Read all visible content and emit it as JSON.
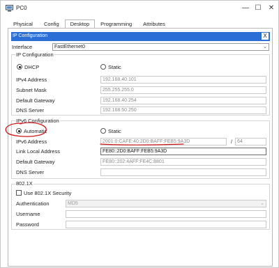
{
  "window": {
    "title": "PC0"
  },
  "tabs": [
    "Physical",
    "Config",
    "Desktop",
    "Programming",
    "Attributes"
  ],
  "ip_config": {
    "header": "IP Configuration",
    "close": "X",
    "interface_label": "Interface",
    "interface_value": "FastEthernet0",
    "ipv4_section": "IP Configuration",
    "dhcp_label": "DHCP",
    "static_label": "Static",
    "ipv4_address_label": "IPv4 Address",
    "ipv4_address": "192.168.40.101",
    "subnet_mask_label": "Subnet Mask",
    "subnet_mask": "255.255.255.0",
    "default_gateway_label": "Default Gateway",
    "default_gateway": "192.168.40.254",
    "dns_server_label": "DNS Server",
    "dns_server": "192.168.50.250",
    "ipv6_section": "IPv6 Configuration",
    "automatic_label": "Automatic",
    "static6_label": "Static",
    "ipv6_address_label": "IPv6 Address",
    "ipv6_address": "2001:0:CAFE:40:2D0:BAFF:FEB5:9A3D",
    "slash": "/",
    "prefix": "64",
    "link_local_label": "Link Local Address",
    "link_local": "FE80::2D0:BAFF:FEB5:9A3D",
    "default_gateway6_label": "Default Gateway",
    "default_gateway6": "FE80::202:4AFF:FE4C:8801",
    "dns_server6_label": "DNS Server",
    "dns_server6": "",
    "dot1x_section": "802.1X",
    "use_8021x_label": "Use 802.1X Security",
    "authentication_label": "Authentication",
    "authentication_value": "MD5",
    "username_label": "Username",
    "password_label": "Password"
  },
  "colors": {
    "header_bg": "#2b6fd6",
    "annotation_red": "#d01515"
  }
}
